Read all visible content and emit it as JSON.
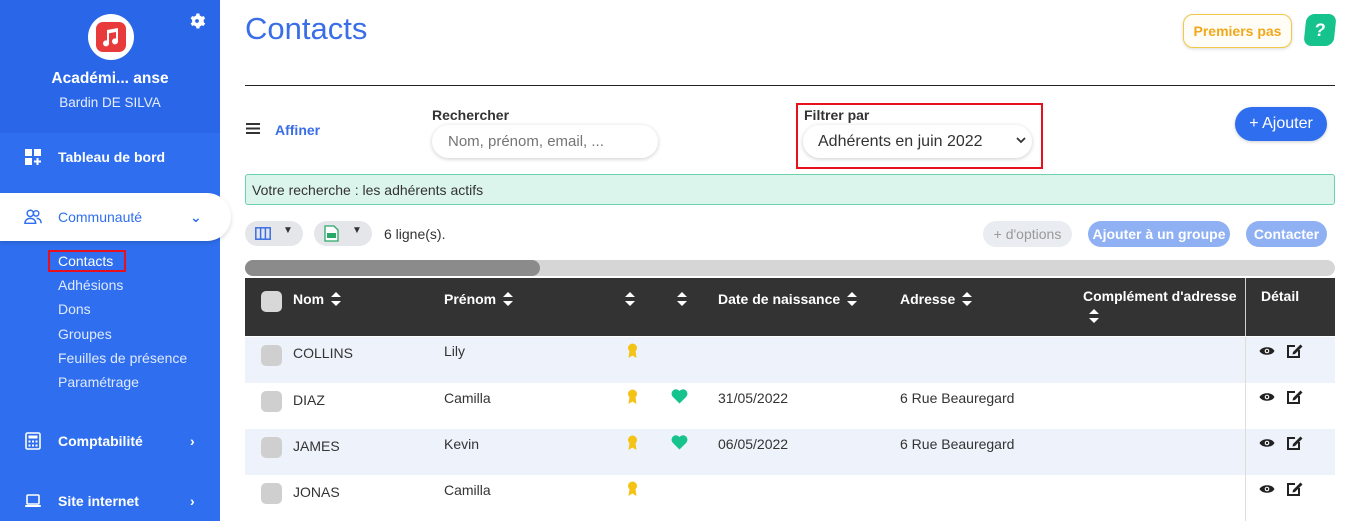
{
  "sidebar": {
    "org_name": "Académi... anse",
    "user_name": "Bardin DE SILVA",
    "nav": [
      {
        "label": "Tableau de bord"
      },
      {
        "label": "Communauté"
      },
      {
        "label": "Comptabilité"
      },
      {
        "label": "Site internet"
      }
    ],
    "sub_items": [
      {
        "label": "Contacts"
      },
      {
        "label": "Adhésions"
      },
      {
        "label": "Dons"
      },
      {
        "label": "Groupes"
      },
      {
        "label": "Feuilles de présence"
      },
      {
        "label": "Paramétrage"
      }
    ]
  },
  "header": {
    "title": "Contacts",
    "premiers_pas": "Premiers pas",
    "help": "?"
  },
  "filters": {
    "affiner": "Affiner",
    "search_label": "Rechercher",
    "search_placeholder": "Nom, prénom, email, ...",
    "filter_label": "Filtrer par",
    "filter_value": "Adhérents en juin 2022",
    "add_button": "+ Ajouter"
  },
  "search_note": "Votre recherche : les adhérents actifs",
  "toolbar": {
    "rows_count": "6 ligne(s).",
    "more_options": "+ d'options",
    "add_to_group": "Ajouter à un groupe",
    "contact": "Contacter"
  },
  "table": {
    "headers": {
      "nom": "Nom",
      "prenom": "Prénom",
      "date": "Date de naissance",
      "adresse": "Adresse",
      "complement": "Complément d'adresse",
      "detail": "Détail"
    },
    "rows": [
      {
        "nom": "COLLINS",
        "prenom": "Lily",
        "date": "",
        "adresse": ""
      },
      {
        "nom": "DIAZ",
        "prenom": "Camilla",
        "date": "31/05/2022",
        "adresse": "6 Rue Beauregard"
      },
      {
        "nom": "JAMES",
        "prenom": "Kevin",
        "date": "06/05/2022",
        "adresse": "6 Rue Beauregard"
      },
      {
        "nom": "JONAS",
        "prenom": "Camilla",
        "date": "",
        "adresse": ""
      }
    ]
  },
  "colors": {
    "primary": "#2f6fef",
    "accent_green": "#16c38d",
    "medal": "#f4c316",
    "highlight_red": "#e8101d",
    "table_header": "#333333"
  }
}
